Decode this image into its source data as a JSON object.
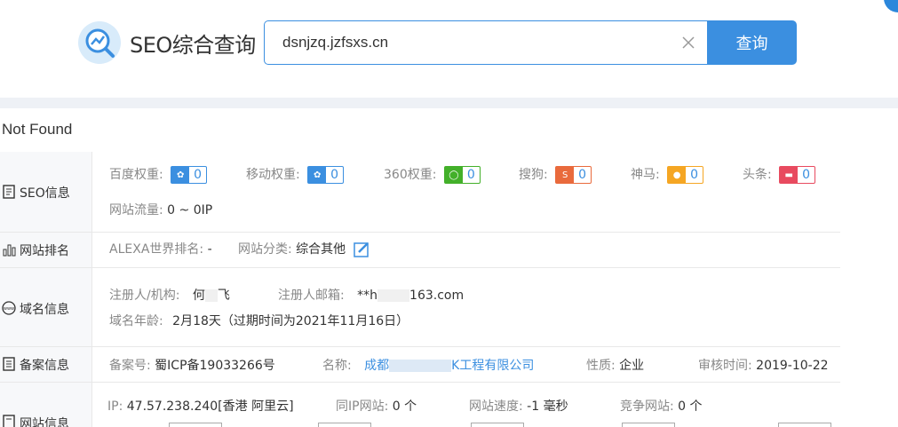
{
  "header": {
    "logo_text": "SEO综合查询",
    "search_value": "dsnjzq.jzfsxs.cn",
    "search_button": "查询"
  },
  "status": "Not Found",
  "seo_info": {
    "label": "SEO信息",
    "baidu": {
      "key": "百度权重:",
      "value": "0",
      "color": "#3b8fe0"
    },
    "mobile": {
      "key": "移动权重:",
      "value": "0",
      "color": "#3b8fe0"
    },
    "r360": {
      "key": "360权重:",
      "value": "0",
      "color": "#43b02a"
    },
    "sogou": {
      "key": "搜狗:",
      "value": "0",
      "color": "#e96a3c"
    },
    "shenma": {
      "key": "神马:",
      "value": "0",
      "color": "#f5a623"
    },
    "toutiao": {
      "key": "头条:",
      "value": "0",
      "color": "#e84a5f"
    },
    "traffic_key": "网站流量:",
    "traffic_value": "0 ~ 0IP"
  },
  "ranking": {
    "label": "网站排名",
    "alexa_key": "ALEXA世界排名:",
    "alexa_value": "-",
    "category_key": "网站分类:",
    "category_value": "综合其他"
  },
  "domain": {
    "label": "域名信息",
    "registrant_key": "注册人/机构:",
    "registrant_value_a": "何",
    "registrant_value_b": "飞",
    "email_key": "注册人邮箱:",
    "email_value_a": "**h",
    "email_value_b": "163.com",
    "age_key": "域名年龄:",
    "age_value": "2月18天（过期时间为2021年11月16日）"
  },
  "icp": {
    "label": "备案信息",
    "no_key": "备案号:",
    "no_value": "蜀ICP备19033266号",
    "name_key": "名称:",
    "name_value_a": "成都",
    "name_value_b": "K工程有限公司",
    "type_key": "性质:",
    "type_value": "企业",
    "audit_key": "审核时间:",
    "audit_value": "2019-10-22"
  },
  "site": {
    "label": "网站信息",
    "ip_key": "IP:",
    "ip_value": "47.57.238.240[香港 阿里云]",
    "same_ip_key": "同IP网站:",
    "same_ip_value": "0 个",
    "speed_key": "网站速度:",
    "speed_value": "-1 毫秒",
    "compete_key": "竞争网站:",
    "compete_value": "0 个"
  }
}
